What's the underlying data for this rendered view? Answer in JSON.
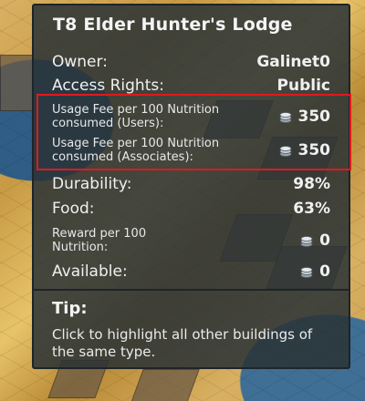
{
  "tooltip": {
    "title": "T8 Elder Hunter's Lodge",
    "owner": {
      "label": "Owner:",
      "value": "Galinet0"
    },
    "access_rights": {
      "label": "Access Rights:",
      "value": "Public"
    },
    "usage_fee_users": {
      "label": "Usage Fee per 100 Nutrition consumed (Users):",
      "value": "350",
      "icon": "silver-coin-icon"
    },
    "usage_fee_associates": {
      "label": "Usage Fee per 100 Nutrition consumed (Associates):",
      "value": "350",
      "icon": "silver-coin-icon"
    },
    "durability": {
      "label": "Durability:",
      "value": "98%"
    },
    "food": {
      "label": "Food:",
      "value": "63%"
    },
    "reward": {
      "label": "Reward per 100 Nutrition:",
      "value": "0",
      "icon": "silver-coin-icon"
    },
    "available": {
      "label": "Available:",
      "value": "0",
      "icon": "silver-coin-icon"
    },
    "tip": {
      "title": "Tip:",
      "body": "Click to highlight all other buildings of the same type."
    }
  },
  "colors": {
    "highlight_border": "#e0191f",
    "panel_bg": "#2a3236"
  }
}
